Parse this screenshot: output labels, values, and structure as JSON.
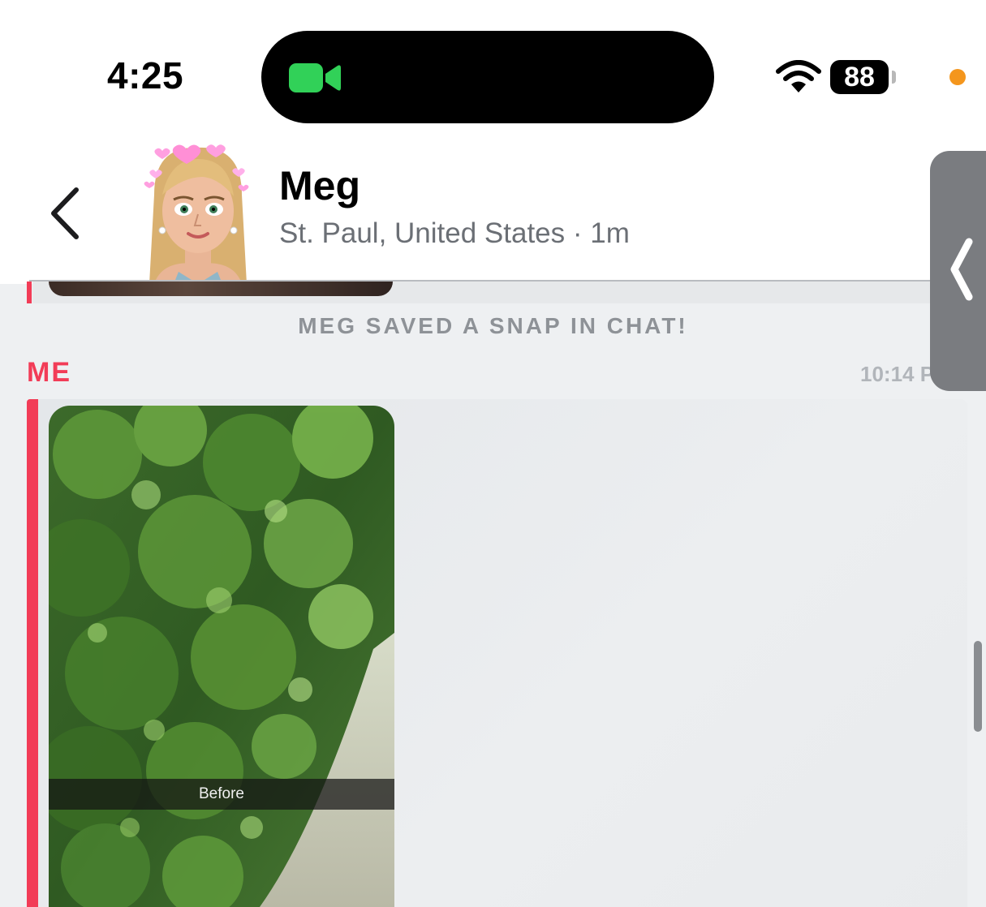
{
  "status_bar": {
    "time": "4:25",
    "battery_level": "88",
    "icons": [
      "facetime-video-icon",
      "wifi-icon",
      "battery-icon",
      "mic-indicator-dot"
    ]
  },
  "header": {
    "contact_name": "Meg",
    "contact_status": "St. Paul, United States · 1m",
    "back_icon": "chevron-left-icon"
  },
  "chat": {
    "system_message": "MEG SAVED A SNAP IN CHAT!",
    "sender_label": "ME",
    "timestamp": "10:14 P",
    "snap_caption": "Before"
  },
  "colors": {
    "accent_red": "#f23c57",
    "facetime_green": "#31d158",
    "mic_orange": "#f4961d",
    "bubble_gray": "#e6e8ea"
  }
}
